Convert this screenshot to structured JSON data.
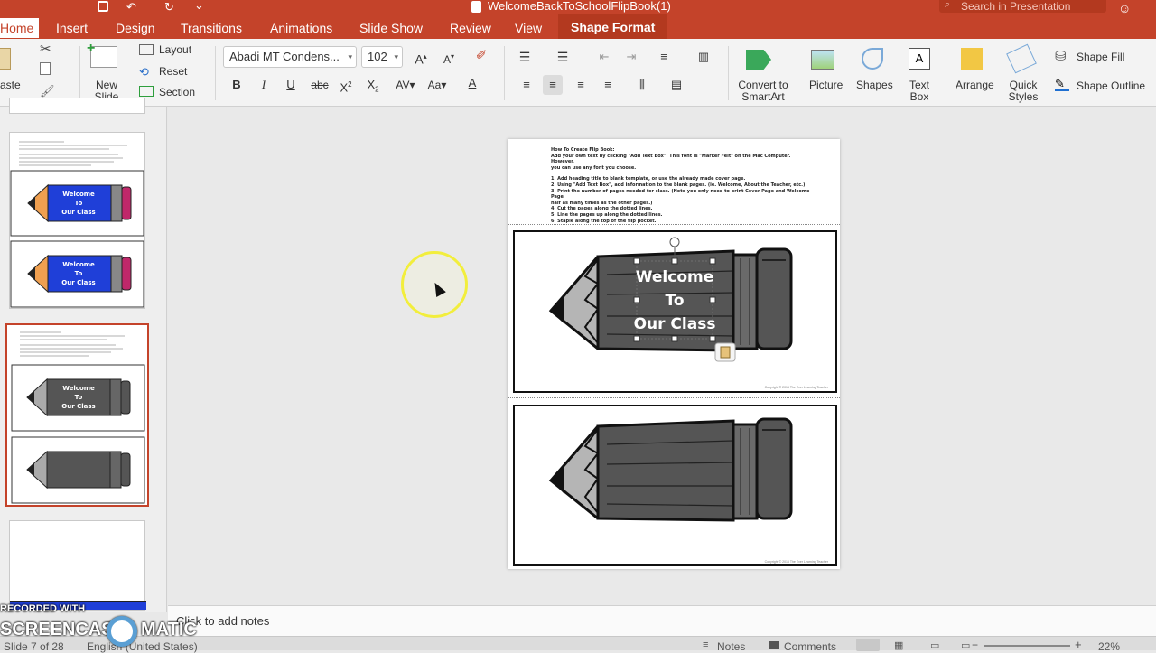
{
  "window": {
    "title": "WelcomeBackToSchoolFlipBook(1)",
    "search_placeholder": "Search in Presentation"
  },
  "tabs": [
    "Home",
    "Insert",
    "Design",
    "Transitions",
    "Animations",
    "Slide Show",
    "Review",
    "View",
    "Shape Format"
  ],
  "ribbon": {
    "paste": "aste",
    "new_slide": "New\nSlide",
    "layout": "Layout",
    "reset": "Reset",
    "section": "Section",
    "font_name": "Abadi MT Condens...",
    "font_size": "102",
    "convert": "Convert to\nSmartArt",
    "picture": "Picture",
    "shapes": "Shapes",
    "text_box": "Text\nBox",
    "arrange": "Arrange",
    "quick_styles": "Quick\nStyles",
    "shape_fill": "Shape Fill",
    "shape_outline": "Shape Outline"
  },
  "slide": {
    "instructions_title": "How To Create Flip Book:",
    "instructions_lines": [
      "Add your own text by clicking \"Add Text Box\". This font is \"Marker Felt\" on the Mac Computer. However,",
      "you can use any font you choose.",
      "",
      "1. Add heading title to blank template, or use the already made cover page.",
      "2. Using \"Add Text Box\", add information to the blank pages. (ie. Welcome, About the Teacher, etc.)",
      "3. Print the number of pages needed for class. (Note you only need to print Cover Page and Welcome Page",
      "half as many times as the other pages.)",
      "4. Cut the pages along the dotted lines.",
      "5. Line the pages up along the dotted lines.",
      "6. Staple along the top of the flip pocket."
    ],
    "welcome_lines": [
      "Welcome",
      "To",
      "Our Class"
    ],
    "copyright": "Copyright © 2016 The Ever Learning Teacher"
  },
  "thumbnails": {
    "welcome_lines": [
      "Welcome",
      "To",
      "Our Class"
    ]
  },
  "notes": {
    "placeholder": "Click to add notes"
  },
  "status": {
    "slide_info": "Slide 7 of 28",
    "language": "English (United States)",
    "notes": "Notes",
    "comments": "Comments",
    "zoom": "22%"
  },
  "watermark": {
    "line1": "RECORDED WITH",
    "line2": "SCREENCAST",
    "line3": "MATIC"
  },
  "colors": {
    "accent": "#c4432a",
    "pencil_blue": "#1f3fd8",
    "pencil_gray": "#555555",
    "highlight": "#f2ee3c"
  }
}
